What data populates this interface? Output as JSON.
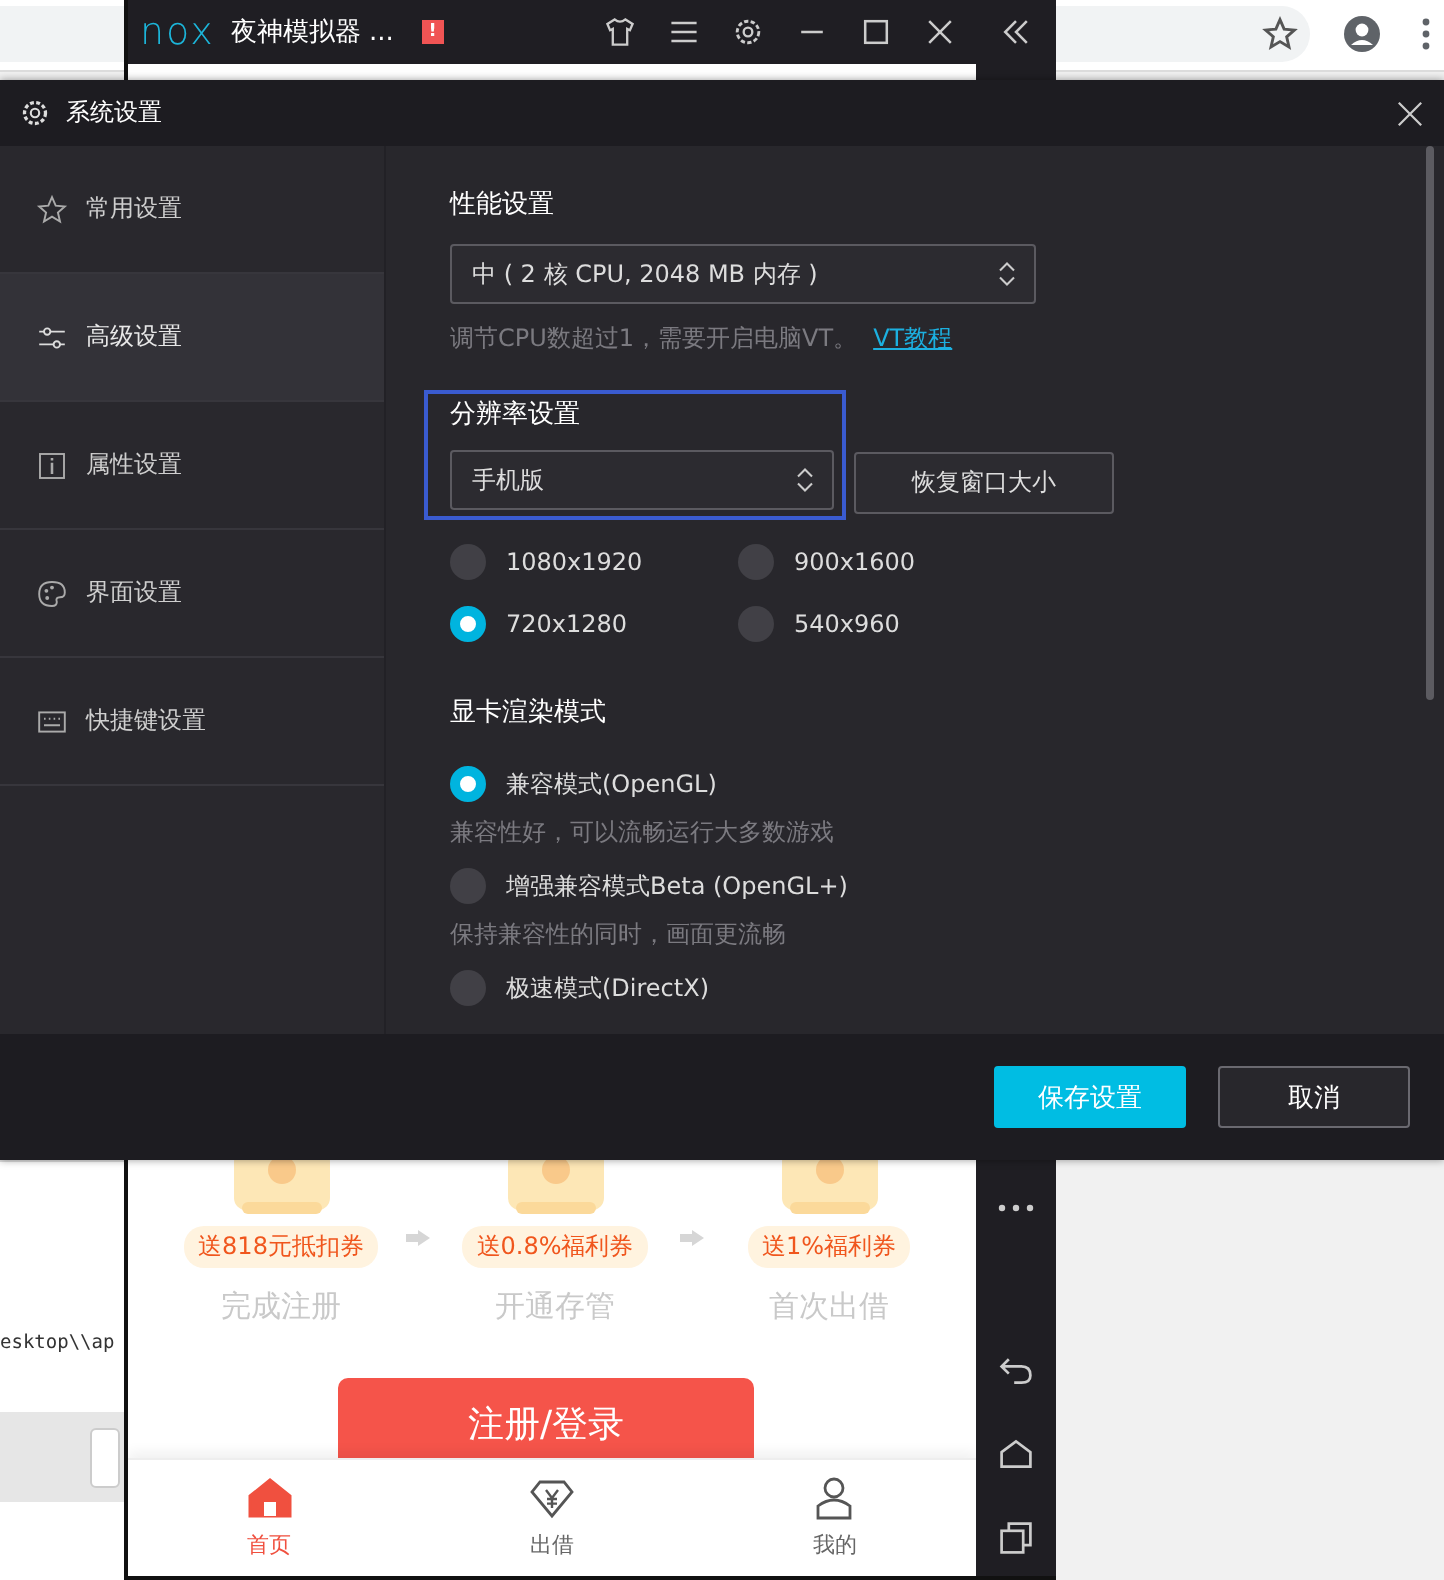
{
  "browser": {
    "page_text": "esktop\\\\ap"
  },
  "emulator": {
    "logo": "nox",
    "title": "夜神模拟器 ...",
    "alert_badge": "!",
    "app": {
      "steps": [
        {
          "reward": "送818元抵扣券",
          "label": "完成注册"
        },
        {
          "reward": "送0.8%福利券",
          "label": "开通存管"
        },
        {
          "reward": "送1%福利券",
          "label": "首次出借"
        }
      ],
      "primary_button": "注册/登录",
      "tabs": [
        {
          "label": "首页",
          "selected": true
        },
        {
          "label": "出借",
          "selected": false
        },
        {
          "label": "我的",
          "selected": false
        }
      ]
    }
  },
  "dialog": {
    "title": "系统设置",
    "sidebar": {
      "items": [
        {
          "label": "常用设置",
          "selected": false
        },
        {
          "label": "高级设置",
          "selected": true
        },
        {
          "label": "属性设置",
          "selected": false
        },
        {
          "label": "界面设置",
          "selected": false
        },
        {
          "label": "快捷键设置",
          "selected": false
        }
      ]
    },
    "performance": {
      "heading": "性能设置",
      "select": "中 ( 2 核 CPU, 2048 MB 内存 )",
      "hint": "调节CPU数超过1，需要开启电脑VT。",
      "link": "VT教程"
    },
    "resolution": {
      "heading": "分辨率设置",
      "select": "手机版",
      "button": "恢复窗口大小",
      "options": [
        {
          "label": "1080x1920",
          "selected": false
        },
        {
          "label": "900x1600",
          "selected": false
        },
        {
          "label": "720x1280",
          "selected": true
        },
        {
          "label": "540x960",
          "selected": false
        }
      ]
    },
    "render": {
      "heading": "显卡渲染模式",
      "options": [
        {
          "label": "兼容模式(OpenGL)",
          "selected": true,
          "description": "兼容性好，可以流畅运行大多数游戏"
        },
        {
          "label": "增强兼容模式Beta (OpenGL+)",
          "selected": false,
          "description": "保持兼容性的同时，画面更流畅"
        },
        {
          "label": "极速模式(DirectX)",
          "selected": false
        }
      ]
    },
    "buttons": [
      {
        "label": "保存设置",
        "kind": "primary"
      },
      {
        "label": "取消",
        "kind": "secondary"
      }
    ]
  }
}
